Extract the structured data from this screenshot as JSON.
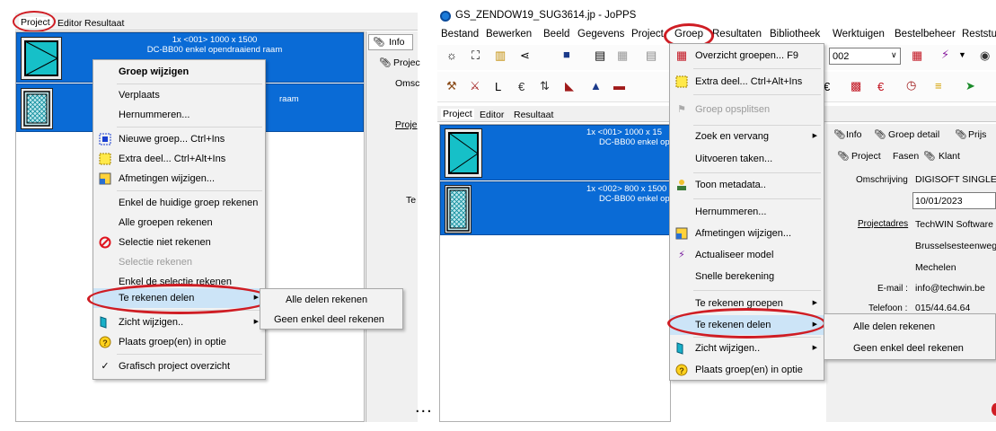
{
  "left": {
    "tabs": [
      "Project",
      "Editor",
      "Resultaat"
    ],
    "rows": [
      {
        "line1": "1x <001> 1000 x 1500",
        "line2": "DC-BB00 enkel opendraaiend raam"
      },
      {
        "line1": "",
        "line2": "raam"
      }
    ],
    "right_tabs": {
      "info": "Info",
      "project": "Projec",
      "omsc": "Omsc",
      "proj": "Proje",
      "te": "Te"
    },
    "menu": {
      "title": "Groep wijzigen",
      "verplaats": "Verplaats",
      "hernummeren": "Hernummeren...",
      "nieuwe_groep": "Nieuwe groep... Ctrl+Ins",
      "extra_deel": "Extra deel... Ctrl+Alt+Ins",
      "afmetingen": "Afmetingen wijzigen...",
      "enkel_huidige": "Enkel de huidige groep rekenen",
      "alle_groepen": "Alle groepen rekenen",
      "selectie_niet": "Selectie niet rekenen",
      "selectie_rekenen": "Selectie rekenen",
      "enkel_selectie": "Enkel de selectie rekenen",
      "te_rekenen": "Te rekenen delen",
      "zicht": "Zicht wijzigen..",
      "plaats": "Plaats groep(en) in optie",
      "grafisch": "Grafisch project overzicht"
    },
    "submenu": {
      "alle": "Alle delen rekenen",
      "geen": "Geen enkel deel rekenen"
    }
  },
  "ellipsis": "...",
  "right": {
    "title": "GS_ZENDOW19_SUG3614.jp - JoPPS",
    "menubar": [
      "Bestand",
      "Bewerken",
      "Beeld",
      "Gegevens",
      "Project",
      "Groep",
      "Resultaten",
      "Bibliotheek",
      "Werktuigen",
      "Bestelbeheer",
      "Reststu"
    ],
    "combo_value": "002",
    "tabs": [
      "Project",
      "Editor",
      "Resultaat"
    ],
    "rows": [
      {
        "line1": "1x <001> 1000 x 15",
        "line2": "DC-BB00 enkel op"
      },
      {
        "line1": "1x <002> 800 x 1500",
        "line2": "DC-BB00 enkel op"
      }
    ],
    "info_tabs": {
      "info": "Info",
      "groep_detail": "Groep detail",
      "prijs": "Prijs"
    },
    "sub_tabs": {
      "project": "Project",
      "fasen": "Fasen",
      "klant": "Klant"
    },
    "fields": {
      "omschrijving_label": "Omschrijving",
      "omschrijving": "DIGISOFT SINGLE",
      "datum": "10/01/2023",
      "projectadres_label": "Projectadres",
      "adres1": "TechWIN Software",
      "adres2": "Brusselsesteenweg",
      "adres3": "Mechelen",
      "email_label": "E-mail :",
      "email": "info@techwin.be",
      "telefoon_label": "Telefoon :",
      "telefoon": "015/44.64.64"
    },
    "menu": {
      "overzicht": "Overzicht groepen... F9",
      "extra_deel": "Extra deel... Ctrl+Alt+Ins",
      "opsplitsen": "Groep opsplitsen",
      "zoek": "Zoek en vervang",
      "uitvoeren": "Uitvoeren taken...",
      "metadata": "Toon metadata..",
      "hernummeren": "Hernummeren...",
      "afmetingen": "Afmetingen wijzigen...",
      "actualiseer": "Actualiseer model",
      "snelle": "Snelle berekening",
      "te_rekenen_groepen": "Te rekenen groepen",
      "te_rekenen_delen": "Te rekenen delen",
      "zicht": "Zicht wijzigen..",
      "plaats": "Plaats groep(en) in optie"
    },
    "submenu": {
      "alle": "Alle delen rekenen",
      "geen": "Geen enkel deel rekenen"
    }
  },
  "colors": {
    "selection": "#0a6bd6",
    "menu_bg": "#f2f2f2",
    "highlight": "#cce4f7",
    "annotation": "#cf1d24"
  }
}
